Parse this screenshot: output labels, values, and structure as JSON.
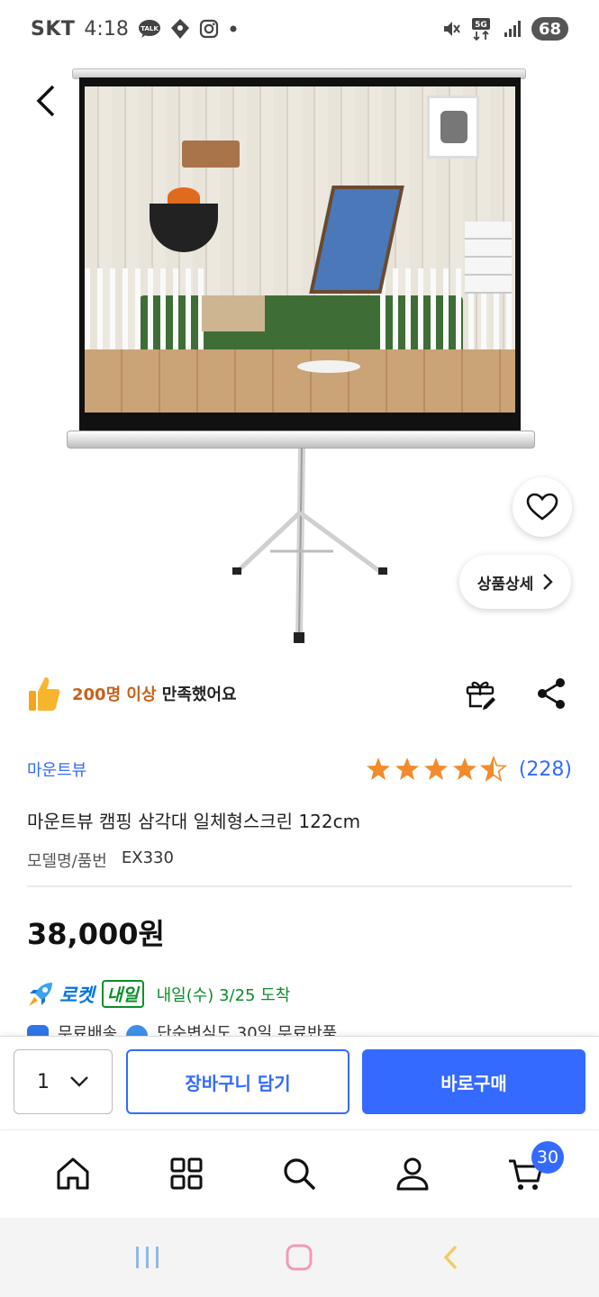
{
  "status_bar": {
    "carrier": "SKT",
    "time": "4:18",
    "talk_label": "TALK",
    "network": "5G",
    "battery": "68"
  },
  "hero": {
    "detail_button_label": "상품상세"
  },
  "satisfaction": {
    "highlight": "200명 이상",
    "rest": " 만족했어요"
  },
  "product": {
    "brand": "마운트뷰",
    "rating": 4.5,
    "review_count": "(228)",
    "title": "마운트뷰 캠핑 삼각대 일체형스크린 122cm",
    "model_label": "모델명/품번",
    "model_value": "EX330",
    "price": "38,000원"
  },
  "delivery": {
    "rocket_label": "로켓",
    "rocket_badge": "내일",
    "arrival": "내일(수) 3/25 도착",
    "free_shipping": "무료배송",
    "free_return": "단순변심도 30일 무료반품"
  },
  "purchase_bar": {
    "quantity": "1",
    "cart_label": "장바구니 담기",
    "buy_label": "바로구매"
  },
  "bottom_nav": {
    "cart_badge": "30"
  },
  "colors": {
    "accent_blue": "#346aff",
    "rocket_green": "#0a8f28",
    "highlight_orange": "#c8611b",
    "star": "#f28b2c"
  },
  "icons": [
    "back-icon",
    "heart-icon",
    "chevron-right-icon",
    "thumbs-up-icon",
    "gift-icon",
    "share-icon",
    "star-icon",
    "rocket-icon",
    "chevron-down-icon",
    "home-icon",
    "category-icon",
    "search-icon",
    "person-icon",
    "cart-icon"
  ]
}
